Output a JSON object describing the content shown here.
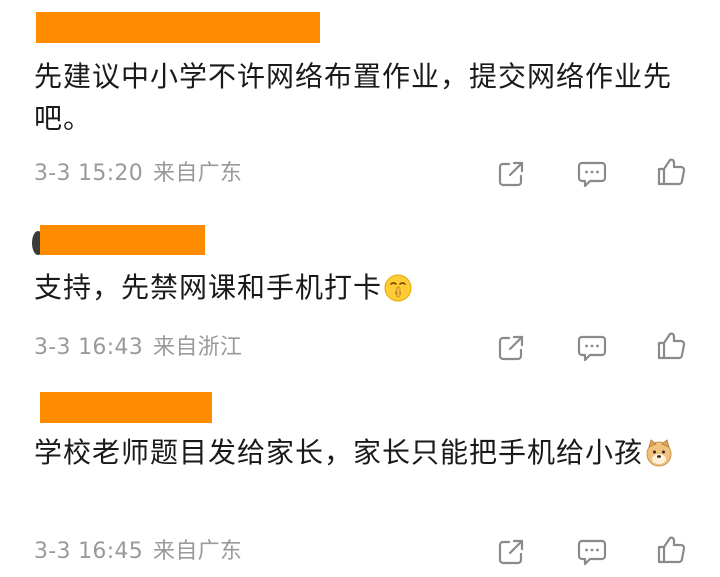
{
  "comments": [
    {
      "text": "先建议中小学不许网络布置作业，提交网络作业先吧。",
      "time": "3-3 15:20",
      "location": "来自广东",
      "emoji": null
    },
    {
      "text": "支持，先禁网课和手机打卡",
      "time": "3-3 16:43",
      "location": "来自浙江",
      "emoji": "shushing-face-emoji"
    },
    {
      "text": "学校老师题目发给家长，家长只能把手机给小孩",
      "time": "3-3 16:45",
      "location": "来自广东",
      "emoji": "doge-emoji"
    }
  ],
  "icons": {
    "share": "share-icon",
    "comment": "comment-icon",
    "like": "thumbs-up-icon"
  },
  "colors": {
    "redaction": "#ff8c00",
    "text": "#1a1a1a",
    "meta": "#9a9a9a",
    "icon": "#8a8a8a"
  }
}
